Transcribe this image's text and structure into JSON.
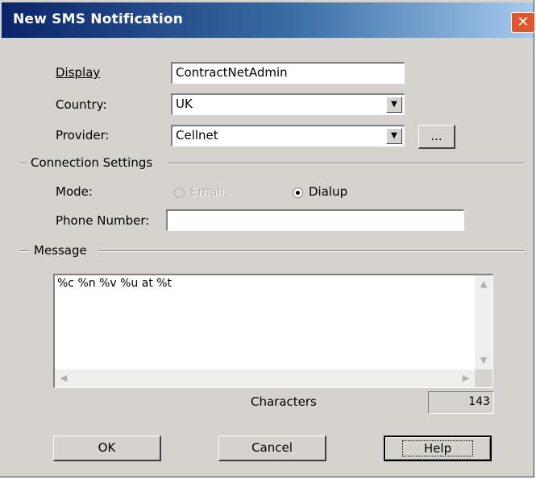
{
  "window": {
    "title": "New SMS Notification",
    "close_glyph": "✕"
  },
  "form": {
    "display_label": "Display",
    "display_value": "ContractNetAdmin",
    "country_label": "Country:",
    "country_value": "UK",
    "provider_label": "Provider:",
    "provider_value": "Cellnet",
    "browse_label": "..."
  },
  "connection": {
    "group_label": "Connection Settings",
    "mode_label": "Mode:",
    "mode_options": [
      {
        "label": "Email",
        "selected": false,
        "enabled": false
      },
      {
        "label": "Dialup",
        "selected": true,
        "enabled": true
      }
    ],
    "phone_label": "Phone Number:",
    "phone_value": ""
  },
  "message": {
    "group_label": "Message",
    "text": "%c %n %v %u at %t",
    "characters_label": "Characters",
    "characters_count": "143"
  },
  "buttons": {
    "ok": "OK",
    "cancel": "Cancel",
    "help": "Help"
  },
  "icons": {
    "dropdown": "chevron-down-icon",
    "close": "close-icon"
  },
  "colors": {
    "titlebar_start": "#0a246a",
    "titlebar_end": "#a6caf0",
    "dialog_bg": "#d6d3ce",
    "close_btn": "#e2562e"
  }
}
